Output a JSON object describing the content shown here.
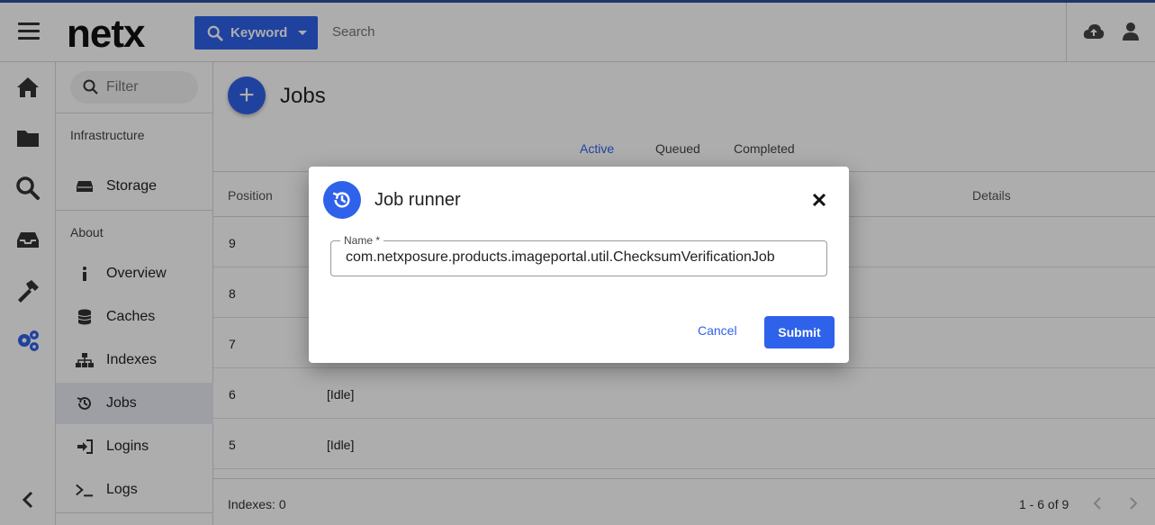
{
  "header": {
    "logo": "netx",
    "keyword_label": "Keyword",
    "search_placeholder": "Search"
  },
  "nav": {
    "filter_placeholder": "Filter",
    "section_infrastructure": "Infrastructure",
    "storage": "Storage",
    "section_about": "About",
    "items": [
      {
        "label": "Overview",
        "icon": "info-icon"
      },
      {
        "label": "Caches",
        "icon": "database-icon"
      },
      {
        "label": "Indexes",
        "icon": "sitemap-icon"
      },
      {
        "label": "Jobs",
        "icon": "history-icon"
      },
      {
        "label": "Logins",
        "icon": "sign-in-icon"
      },
      {
        "label": "Logs",
        "icon": "terminal-icon"
      }
    ],
    "active": "Jobs"
  },
  "main": {
    "title": "Jobs",
    "tabs": [
      "Active",
      "Queued",
      "Completed"
    ],
    "active_tab": "Active",
    "columns": {
      "position": "Position",
      "details": "Details"
    },
    "rows": [
      {
        "position": "9",
        "status": ""
      },
      {
        "position": "8",
        "status": ""
      },
      {
        "position": "7",
        "status": ""
      },
      {
        "position": "6",
        "status": "[Idle]"
      },
      {
        "position": "5",
        "status": "[Idle]"
      }
    ],
    "footer_left": "Indexes: 0",
    "footer_range": "1 - 6 of 9"
  },
  "dialog": {
    "title": "Job runner",
    "field_label": "Name *",
    "field_value": "com.netxposure.products.imageportal.util.ChecksumVerificationJob",
    "cancel": "Cancel",
    "submit": "Submit"
  },
  "colors": {
    "accent": "#2f62ea",
    "rail_active": "#2f62ea"
  }
}
